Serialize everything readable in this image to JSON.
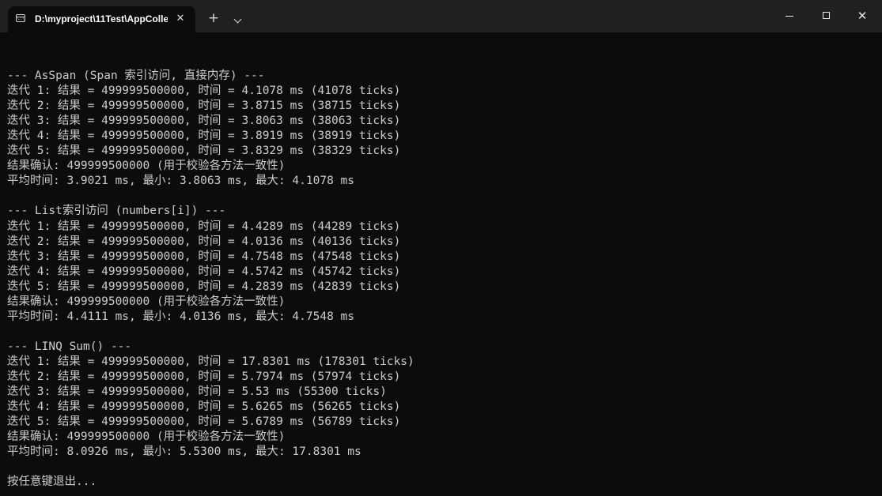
{
  "window": {
    "tab_title": "D:\\myproject\\11Test\\AppColle",
    "tab_icon_text": "C:\\",
    "close_tab_glyph": "✕",
    "new_tab_glyph": "+",
    "close_window_glyph": "✕"
  },
  "colors": {
    "terminal_background": "#0c0c0c",
    "titlebar_background": "#202020",
    "text": "#cccccc"
  },
  "console": {
    "lines": [
      "",
      "--- AsSpan (Span 索引访问, 直接内存) ---",
      "迭代 1: 结果 = 499999500000, 时间 = 4.1078 ms (41078 ticks)",
      "迭代 2: 结果 = 499999500000, 时间 = 3.8715 ms (38715 ticks)",
      "迭代 3: 结果 = 499999500000, 时间 = 3.8063 ms (38063 ticks)",
      "迭代 4: 结果 = 499999500000, 时间 = 3.8919 ms (38919 ticks)",
      "迭代 5: 结果 = 499999500000, 时间 = 3.8329 ms (38329 ticks)",
      "结果确认: 499999500000 (用于校验各方法一致性)",
      "平均时间: 3.9021 ms, 最小: 3.8063 ms, 最大: 4.1078 ms",
      "",
      "--- List索引访问 (numbers[i]) ---",
      "迭代 1: 结果 = 499999500000, 时间 = 4.4289 ms (44289 ticks)",
      "迭代 2: 结果 = 499999500000, 时间 = 4.0136 ms (40136 ticks)",
      "迭代 3: 结果 = 499999500000, 时间 = 4.7548 ms (47548 ticks)",
      "迭代 4: 结果 = 499999500000, 时间 = 4.5742 ms (45742 ticks)",
      "迭代 5: 结果 = 499999500000, 时间 = 4.2839 ms (42839 ticks)",
      "结果确认: 499999500000 (用于校验各方法一致性)",
      "平均时间: 4.4111 ms, 最小: 4.0136 ms, 最大: 4.7548 ms",
      "",
      "--- LINQ Sum() ---",
      "迭代 1: 结果 = 499999500000, 时间 = 17.8301 ms (178301 ticks)",
      "迭代 2: 结果 = 499999500000, 时间 = 5.7974 ms (57974 ticks)",
      "迭代 3: 结果 = 499999500000, 时间 = 5.53 ms (55300 ticks)",
      "迭代 4: 结果 = 499999500000, 时间 = 5.6265 ms (56265 ticks)",
      "迭代 5: 结果 = 499999500000, 时间 = 5.6789 ms (56789 ticks)",
      "结果确认: 499999500000 (用于校验各方法一致性)",
      "平均时间: 8.0926 ms, 最小: 5.5300 ms, 最大: 17.8301 ms",
      "",
      "按任意键退出..."
    ]
  }
}
